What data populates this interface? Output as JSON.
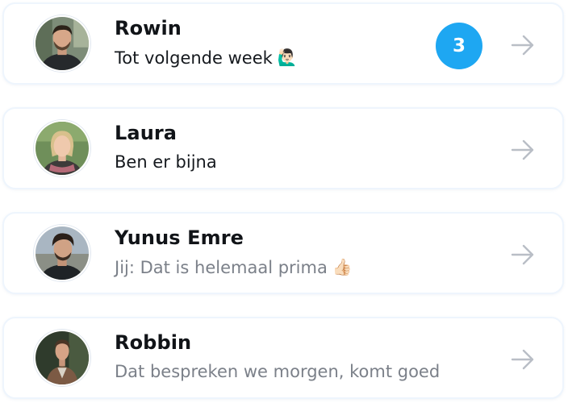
{
  "conversations": [
    {
      "name": "Rowin",
      "preview": "Tot volgende week",
      "preview_emoji": "🙋🏻‍♂️",
      "unread_count": "3",
      "preview_muted": false
    },
    {
      "name": "Laura",
      "preview": "Ben er bijna",
      "preview_emoji": "",
      "unread_count": "",
      "preview_muted": false
    },
    {
      "name": "Yunus Emre",
      "preview": "Jij: Dat is helemaal prima",
      "preview_emoji": "👍🏻",
      "unread_count": "",
      "preview_muted": true
    },
    {
      "name": "Robbin",
      "preview": "Dat bespreken we morgen, komt goed",
      "preview_emoji": "",
      "unread_count": "",
      "preview_muted": true
    }
  ],
  "icons": {
    "row_action": "arrow-right-icon"
  },
  "colors": {
    "badge": "#1ea7f2",
    "arrow": "#b9bec6",
    "card_border": "#eef5fd",
    "muted_text": "#7b8089"
  }
}
